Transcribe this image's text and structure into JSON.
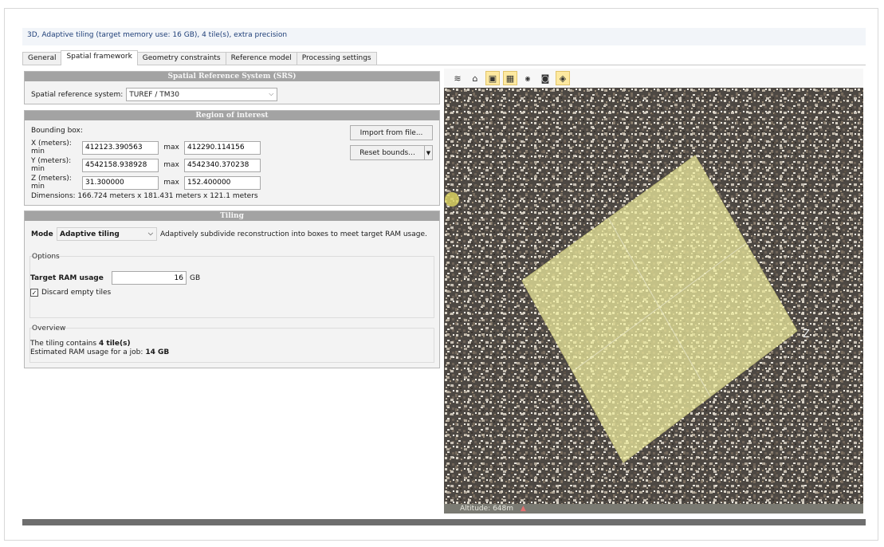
{
  "window": {
    "title": "3D, Adaptive tiling (target memory use: 16 GB), 4 tile(s), extra precision"
  },
  "tabs": [
    {
      "label": "General",
      "active": false
    },
    {
      "label": "Spatial framework",
      "active": true
    },
    {
      "label": "Geometry constraints",
      "active": false
    },
    {
      "label": "Reference model",
      "active": false
    },
    {
      "label": "Processing settings",
      "active": false
    }
  ],
  "srs": {
    "header": "Spatial Reference System (SRS)",
    "label": "Spatial reference system:",
    "value": "TUREF / TM30"
  },
  "roi": {
    "header": "Region of interest",
    "bbox_label": "Bounding box:",
    "x_label": "X (meters): min",
    "y_label": "Y (meters): min",
    "z_label": "Z (meters): min",
    "max_label": "max",
    "x_min": "412123.390563",
    "x_max": "412290.114156",
    "y_min": "4542158.938928",
    "y_max": "4542340.370238",
    "z_min": "31.300000",
    "z_max": "152.400000",
    "dimensions": "Dimensions: 166.724 meters x 181.431 meters x 121.1 meters",
    "import_button": "Import from file...",
    "reset_button": "Reset bounds..."
  },
  "tiling": {
    "header": "Tiling",
    "mode_label": "Mode",
    "mode_value": "Adaptive tiling",
    "mode_description": "Adaptively subdivide reconstruction into boxes to meet target RAM usage.",
    "options_title": "Options",
    "target_ram_label": "Target RAM usage",
    "target_ram_value": "16",
    "target_ram_unit": "GB",
    "discard_label": "Discard empty tiles",
    "discard_checked": true,
    "overview_title": "Overview",
    "overview_line1_prefix": "The tiling contains ",
    "overview_line1_bold": "4 tile(s)",
    "overview_line2_prefix": "Estimated RAM usage for a job: ",
    "overview_line2_bold": "14 GB"
  },
  "viewer": {
    "toolbar_icons": [
      "layers-icon",
      "home-icon",
      "box-icon",
      "grid-icon",
      "camera-small-icon",
      "camera-icon",
      "tile-box-icon"
    ],
    "axis_label": "Z",
    "status_altitude": "Altitude: 648m",
    "tile_color": "#f2f0a0"
  }
}
